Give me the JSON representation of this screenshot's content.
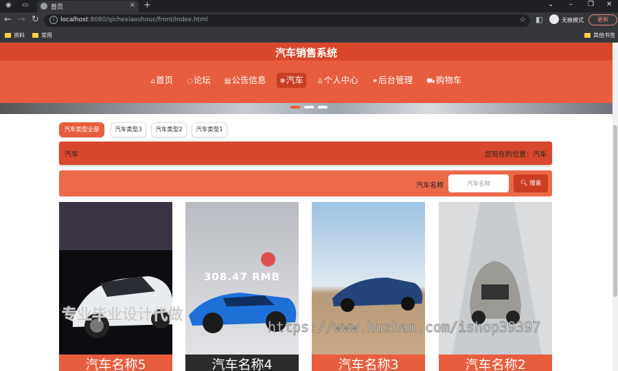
{
  "browser": {
    "tab_title": "首页",
    "url_host": "localhost",
    "url_rest": ":8080/qichexiaoshouc/front/index.html",
    "incognito_label": "无痕模式",
    "update_label": "更新",
    "bookmarks": [
      "资料",
      "常用"
    ],
    "other_bookmarks": "其他书签"
  },
  "site": {
    "title": "汽车销售系统",
    "menu": [
      {
        "icon": "⌂",
        "label": "首页"
      },
      {
        "icon": "◌",
        "label": "论坛"
      },
      {
        "icon": "▤",
        "label": "公告信息"
      },
      {
        "icon": "❄",
        "label": "汽车"
      },
      {
        "icon": "♙",
        "label": "个人中心"
      },
      {
        "icon": "⚭",
        "label": "后台管理"
      },
      {
        "icon": "⛟",
        "label": "购物车"
      }
    ],
    "active_menu": "汽车"
  },
  "types": [
    "汽车类型全部",
    "汽车类型3",
    "汽车类型2",
    "汽车类型1"
  ],
  "breadcrumb": {
    "current": "汽车",
    "location_label": "您现在的位置：",
    "location_value": "汽车"
  },
  "search": {
    "label": "汽车名称",
    "placeholder": "汽车名称",
    "button": "搜索"
  },
  "cards": [
    {
      "name": "汽车名称5",
      "price": ""
    },
    {
      "name": "汽车名称4",
      "price": "308.47 RMB"
    },
    {
      "name": "汽车名称3",
      "price": ""
    },
    {
      "name": "汽车名称2",
      "price": ""
    }
  ],
  "watermarks": {
    "left": "专业毕业设计代做",
    "right": "https://www.huzhan.com/ishop39397"
  }
}
